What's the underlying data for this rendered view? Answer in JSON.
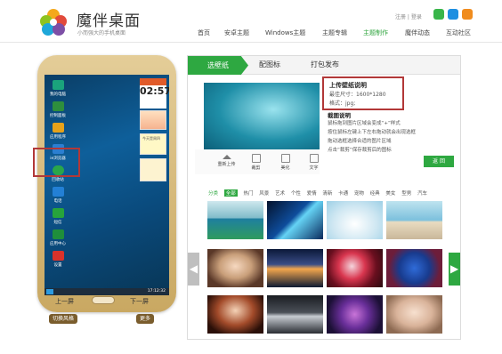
{
  "header": {
    "brand": "魔伴桌面",
    "slogan": "小而强大的手机桌面",
    "login": "注册 | 登录",
    "social": [
      "wechat-icon",
      "qq-icon",
      "weibo-icon"
    ],
    "nav": [
      "首页",
      "安卓主题",
      "Windows主题",
      "主题专辑",
      "主题制作",
      "魔伴动态",
      "互动社区"
    ],
    "active_nav": "主题制作"
  },
  "phone": {
    "apps": [
      "我的电脑",
      "控制面板",
      "应用程序",
      "ie浏览器",
      "回收站",
      "电话",
      "短信",
      "应用中心",
      "设置",
      "我的文档"
    ],
    "clock": {
      "time": "02:57"
    },
    "widget_note": "今天是周四",
    "taskbar_time": "17:12:32",
    "prev_page": "上一屏",
    "next_page": "下一屏",
    "switch_style": "切换风格",
    "more": "更多"
  },
  "editor": {
    "tabs": [
      "选壁纸",
      "配图标",
      "打包发布"
    ],
    "active_tab": "选壁纸",
    "tools": [
      "重新上传",
      "裁剪",
      "美化",
      "文字"
    ],
    "info": {
      "title": "上传壁纸说明",
      "lines": [
        "最佳尺寸：1600*1280",
        "格式：jpg;"
      ]
    },
    "desc": {
      "title": "截图说明",
      "lines": [
        "鼠标拖到图片区域会变成“+”样式",
        "按住鼠标左键上下左右拖动就会出现选框",
        "拖动选框选择合适的图片区域",
        "点击“裁剪”保存裁剪后的图标"
      ]
    },
    "back_button": "返 回",
    "categories": [
      "分类",
      "全部",
      "热门",
      "风景",
      "艺术",
      "个性",
      "爱情",
      "清新",
      "卡通",
      "宠物",
      "经典",
      "美女",
      "型男",
      "汽车"
    ],
    "selected_category": "全部",
    "thumbnails": [
      "island",
      "blue-wave",
      "flowers-hand",
      "beach",
      "boy-portrait",
      "sunset-water",
      "red-flower",
      "girl-lantern",
      "sports-car",
      "purple-lights",
      "girl-hat",
      "wheel"
    ]
  },
  "colors": {
    "accent": "#2ea841",
    "highlight": "#b23838"
  }
}
